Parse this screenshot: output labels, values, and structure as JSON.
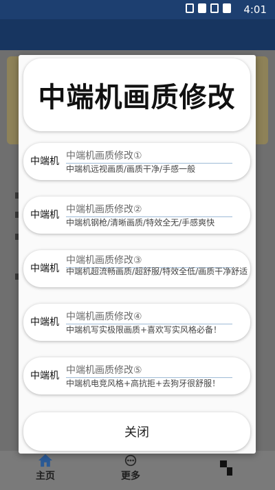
{
  "status_bar": {
    "time": "4:01"
  },
  "dialog": {
    "title": "中端机画质修改",
    "options": [
      {
        "label": "中端机",
        "name": "中端机画质修改①",
        "description": "中端机远视画质/画质干净/手感一般"
      },
      {
        "label": "中端机",
        "name": "中端机画质修改②",
        "description": "中端机钢枪/清晰画质/特效全无/手感爽快"
      },
      {
        "label": "中端机",
        "name": "中端机画质修改③",
        "description": "中端机超流畅画质/超舒服/特效全低/画质干净舒适"
      },
      {
        "label": "中端机",
        "name": "中端机画质修改④",
        "description": "中端机写实极限画质+喜欢写实风格必备！"
      },
      {
        "label": "中端机",
        "name": "中端机画质修改⑤",
        "description": "中端机电竞风格+高抗拒+去狗牙很舒服！"
      }
    ],
    "close_label": "关闭"
  },
  "bottom_nav": {
    "home_label": "主页",
    "more_label": "更多"
  },
  "colors": {
    "status_bar": "#1d3f70",
    "home_icon": "#2b5a96",
    "option_underline": "#9dbad6"
  }
}
